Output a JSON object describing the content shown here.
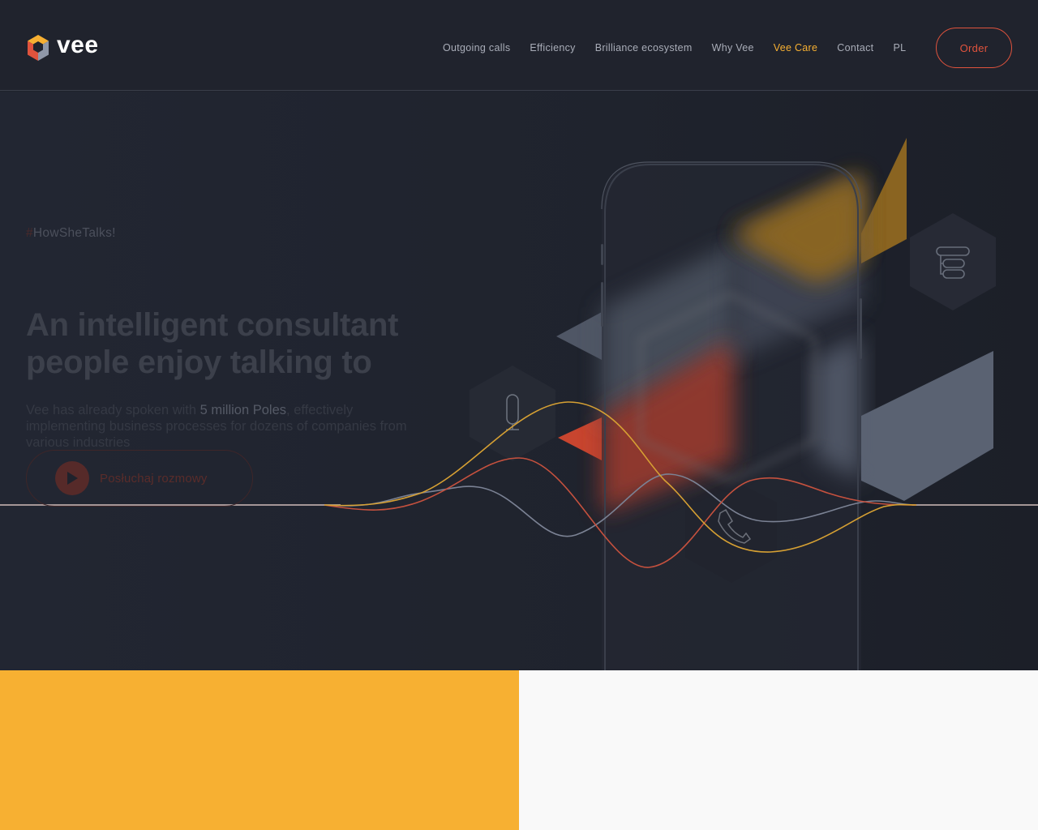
{
  "brand": {
    "name": "vee"
  },
  "nav": {
    "items": [
      {
        "label": "Outgoing calls",
        "active": false
      },
      {
        "label": "Efficiency",
        "active": false
      },
      {
        "label": "Brilliance ecosystem",
        "active": false
      },
      {
        "label": "Why Vee",
        "active": false
      },
      {
        "label": "Vee Care",
        "active": true
      },
      {
        "label": "Contact",
        "active": false
      },
      {
        "label": "PL",
        "active": false
      }
    ],
    "order_label": "Order"
  },
  "hero": {
    "tagline_hash": "#",
    "tagline_text": "HowSheTalks!",
    "headline_line1": "An intelligent consultant",
    "headline_line2": "people enjoy talking to",
    "desc_before": "Vee has already spoken with ",
    "desc_highlight": "5 million Poles",
    "desc_after": ", effectively implementing business processes for dozens of companies from various industries",
    "listen_label": "Posłuchaj rozmowy"
  },
  "icons": {
    "logo": "vee-hexagon-logo",
    "play": "play-icon",
    "microphone": "microphone-icon",
    "phone": "phone-icon",
    "database": "stack-icon"
  },
  "colors": {
    "accent_orange": "#f7b032",
    "accent_red": "#e0533d",
    "background": "#1f222c",
    "slate": "#5a6272",
    "panel_light": "#f9f9f9"
  }
}
